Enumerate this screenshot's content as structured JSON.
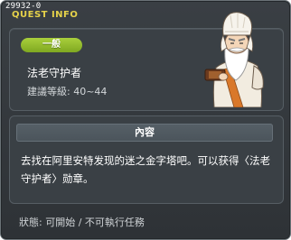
{
  "window": {
    "quest_id": "29932-0",
    "title": "QUEST INFO"
  },
  "info": {
    "type_badge": "一般",
    "quest_name": "法老守护者",
    "recommended_level": "建議等級: 40~44"
  },
  "content": {
    "header": "內容",
    "text": "去找在阿里安特发现的迷之金字塔吧。可以获得〈法老守护者〉勋章。"
  },
  "status": {
    "text": "狀態: 可開始 / 不可執行任務"
  },
  "colors": {
    "title": "#e6d24a",
    "badge": "#8fbb2a",
    "panel": "#3a4045",
    "frame": "#2e3236"
  },
  "icons": {
    "npc": "old-sage-portrait"
  }
}
